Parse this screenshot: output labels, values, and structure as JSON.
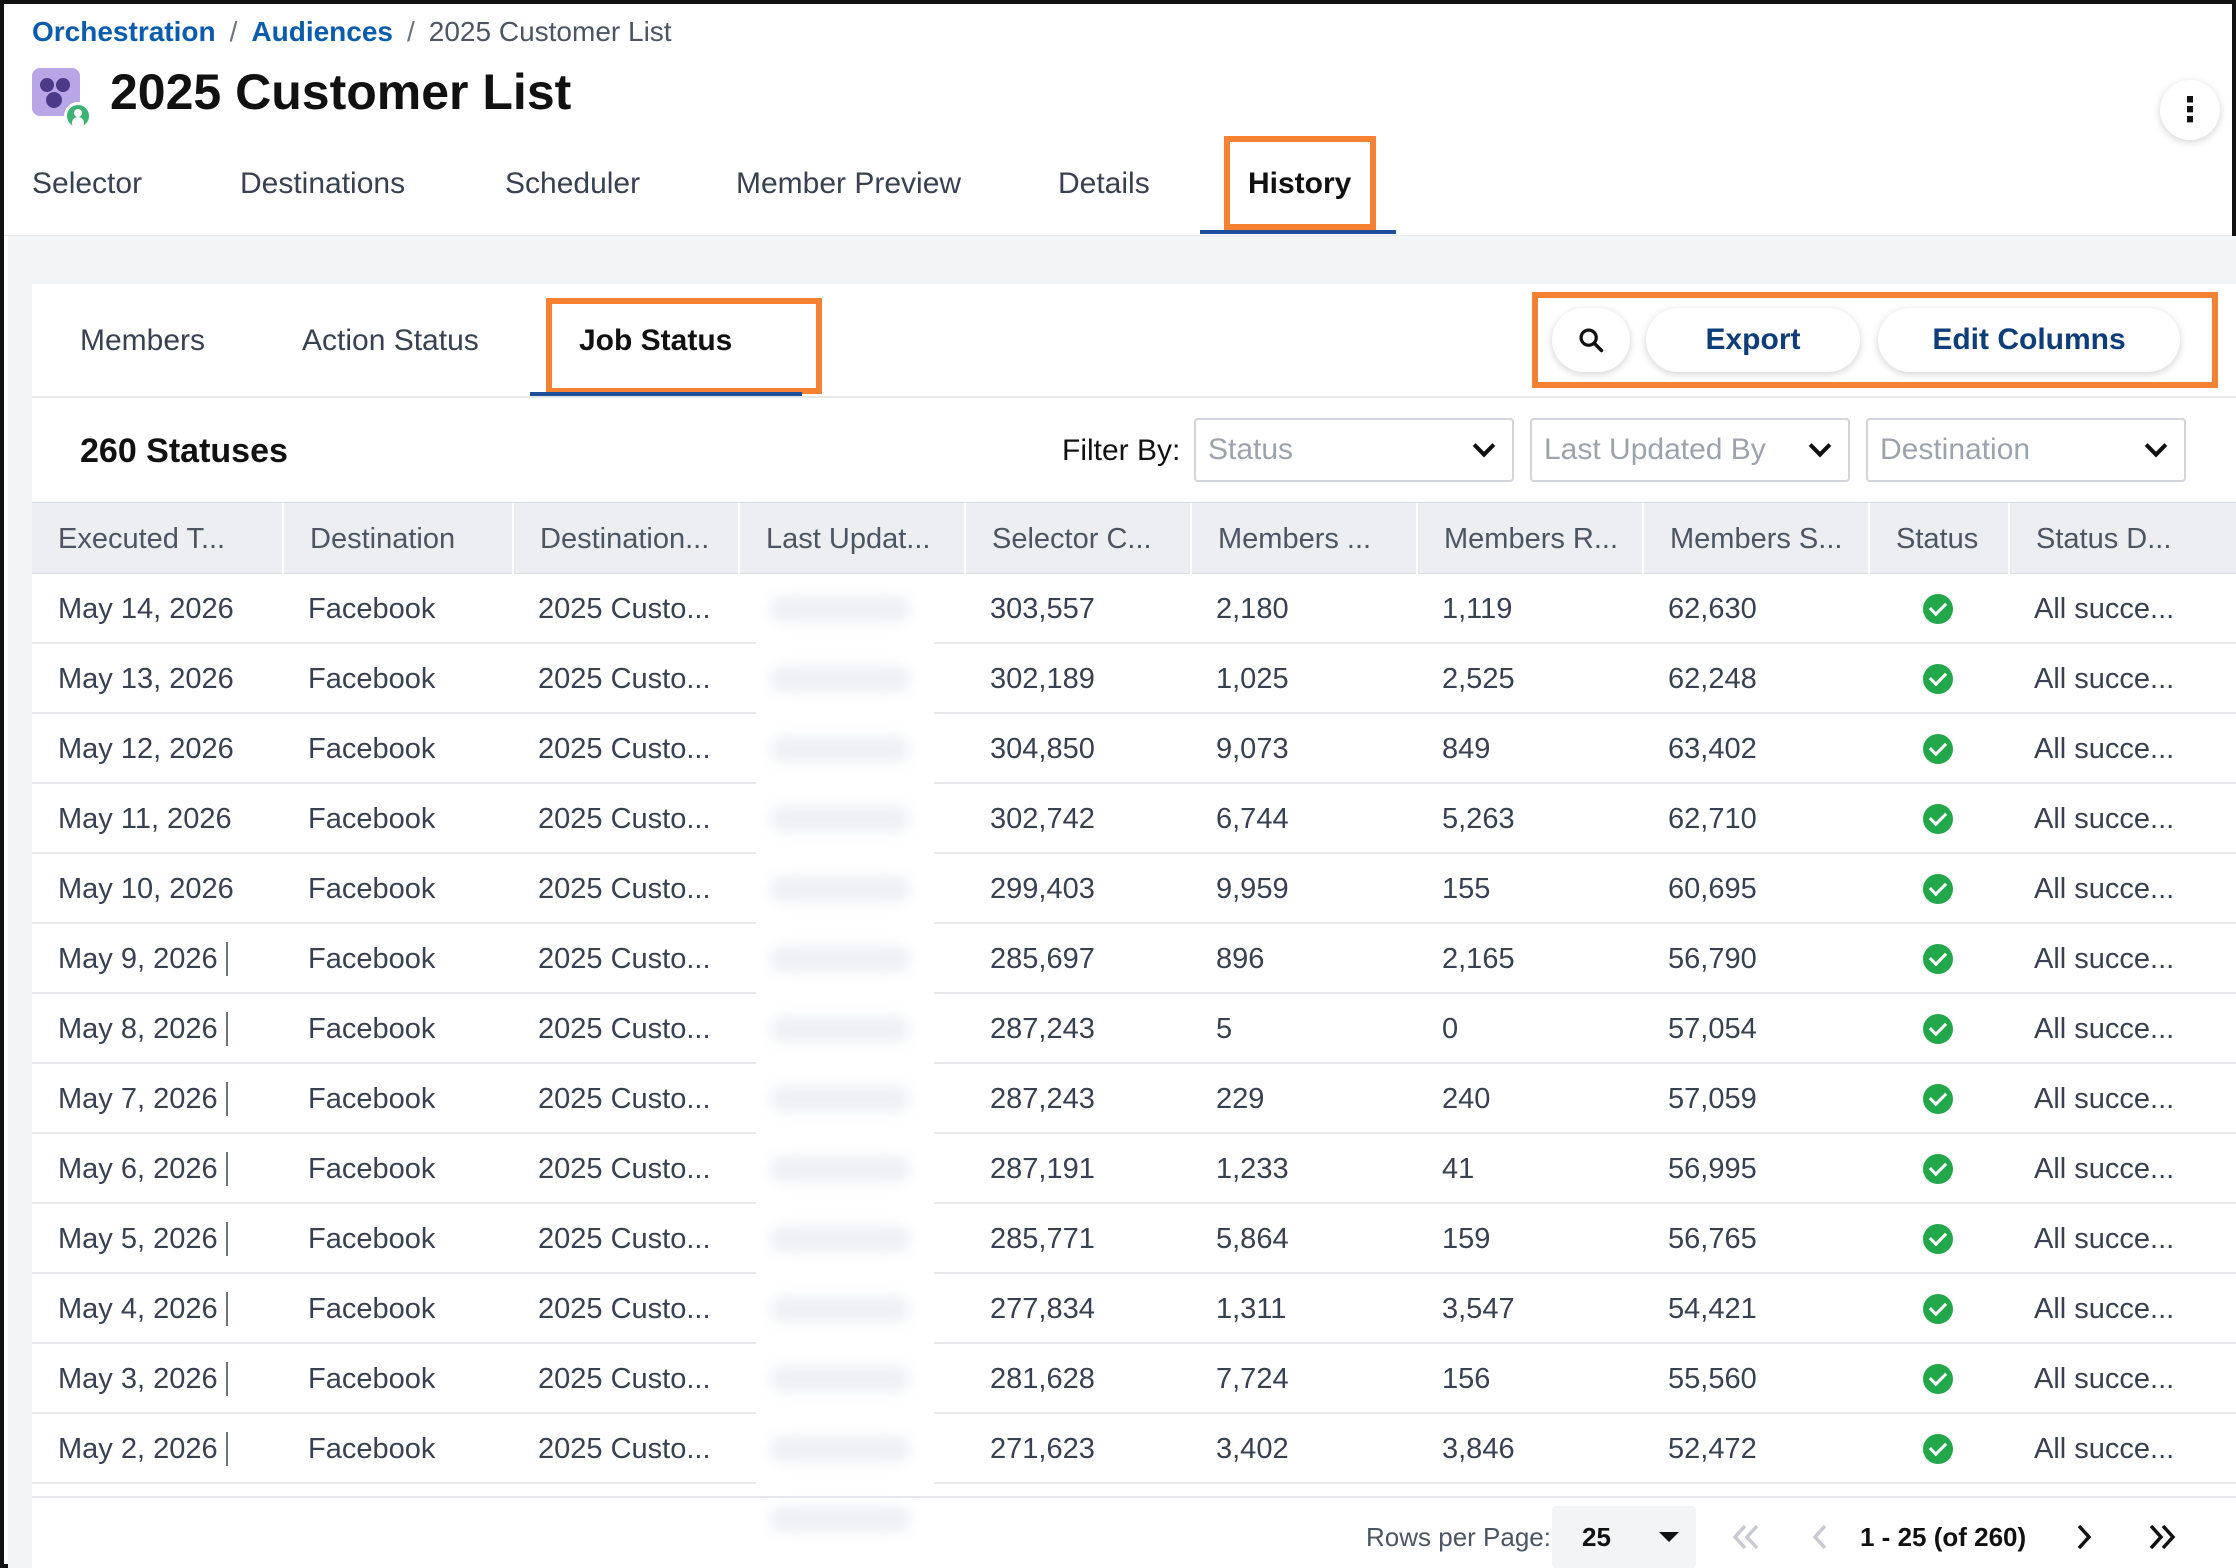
{
  "breadcrumb": {
    "items": [
      "Orchestration",
      "Audiences"
    ],
    "current": "2025 Customer List",
    "separator": "/"
  },
  "page": {
    "title": "2025 Customer List"
  },
  "menu": {
    "kebab_glyph": "⋮"
  },
  "top_tabs": {
    "items": [
      "Selector",
      "Destinations",
      "Scheduler",
      "Member Preview",
      "Details",
      "History"
    ],
    "active": "History"
  },
  "sub_tabs": {
    "items": [
      "Members",
      "Action Status",
      "Job Status"
    ],
    "active": "Job Status"
  },
  "toolbar": {
    "export_label": "Export",
    "edit_columns_label": "Edit Columns"
  },
  "summary": {
    "count_label": "260 Statuses"
  },
  "filters": {
    "label": "Filter By:",
    "status_placeholder": "Status",
    "last_updated_by_placeholder": "Last Updated By",
    "destination_placeholder": "Destination"
  },
  "table": {
    "columns": [
      "Executed T...",
      "Destination",
      "Destination...",
      "Last Updat...",
      "Selector C...",
      "Members ...",
      "Members R...",
      "Members S...",
      "Status",
      "Status D..."
    ],
    "rows": [
      {
        "date": "May 14, 2026",
        "destination": "Facebook",
        "dest_name": "2025 Custo...",
        "selector": "303,557",
        "m1": "2,180",
        "m2": "1,119",
        "m3": "62,630",
        "status_detail": "All succe...",
        "bar": false
      },
      {
        "date": "May 13, 2026",
        "destination": "Facebook",
        "dest_name": "2025 Custo...",
        "selector": "302,189",
        "m1": "1,025",
        "m2": "2,525",
        "m3": "62,248",
        "status_detail": "All succe...",
        "bar": false
      },
      {
        "date": "May 12, 2026",
        "destination": "Facebook",
        "dest_name": "2025 Custo...",
        "selector": "304,850",
        "m1": "9,073",
        "m2": "849",
        "m3": "63,402",
        "status_detail": "All succe...",
        "bar": false
      },
      {
        "date": "May 11, 2026",
        "destination": "Facebook",
        "dest_name": "2025 Custo...",
        "selector": "302,742",
        "m1": "6,744",
        "m2": "5,263",
        "m3": "62,710",
        "status_detail": "All succe...",
        "bar": false
      },
      {
        "date": "May 10, 2026",
        "destination": "Facebook",
        "dest_name": "2025 Custo...",
        "selector": "299,403",
        "m1": "9,959",
        "m2": "155",
        "m3": "60,695",
        "status_detail": "All succe...",
        "bar": false
      },
      {
        "date": "May 9, 2026",
        "destination": "Facebook",
        "dest_name": "2025 Custo...",
        "selector": "285,697",
        "m1": "896",
        "m2": "2,165",
        "m3": "56,790",
        "status_detail": "All succe...",
        "bar": true
      },
      {
        "date": "May 8, 2026",
        "destination": "Facebook",
        "dest_name": "2025 Custo...",
        "selector": "287,243",
        "m1": "5",
        "m2": "0",
        "m3": "57,054",
        "status_detail": "All succe...",
        "bar": true
      },
      {
        "date": "May 7, 2026",
        "destination": "Facebook",
        "dest_name": "2025 Custo...",
        "selector": "287,243",
        "m1": "229",
        "m2": "240",
        "m3": "57,059",
        "status_detail": "All succe...",
        "bar": true
      },
      {
        "date": "May 6, 2026",
        "destination": "Facebook",
        "dest_name": "2025 Custo...",
        "selector": "287,191",
        "m1": "1,233",
        "m2": "41",
        "m3": "56,995",
        "status_detail": "All succe...",
        "bar": true
      },
      {
        "date": "May 5, 2026",
        "destination": "Facebook",
        "dest_name": "2025 Custo...",
        "selector": "285,771",
        "m1": "5,864",
        "m2": "159",
        "m3": "56,765",
        "status_detail": "All succe...",
        "bar": true
      },
      {
        "date": "May 4, 2026",
        "destination": "Facebook",
        "dest_name": "2025 Custo...",
        "selector": "277,834",
        "m1": "1,311",
        "m2": "3,547",
        "m3": "54,421",
        "status_detail": "All succe...",
        "bar": true
      },
      {
        "date": "May 3, 2026",
        "destination": "Facebook",
        "dest_name": "2025 Custo...",
        "selector": "281,628",
        "m1": "7,724",
        "m2": "156",
        "m3": "55,560",
        "status_detail": "All succe...",
        "bar": true
      },
      {
        "date": "May 2, 2026",
        "destination": "Facebook",
        "dest_name": "2025 Custo...",
        "selector": "271,623",
        "m1": "3,402",
        "m2": "3,846",
        "m3": "52,472",
        "status_detail": "All succe...",
        "bar": true
      }
    ]
  },
  "pagination": {
    "rows_per_page_label": "Rows per Page:",
    "rows_per_page": "25",
    "range": "1 - 25 (of 260)"
  },
  "colors": {
    "accent_highlight": "#f58233",
    "link_blue": "#0b5cad",
    "button_text": "#0f3d7a",
    "success_green": "#22a84a"
  },
  "icons": {
    "search": "search-icon",
    "more": "more-vertical-icon",
    "status_ok": "check-circle-icon",
    "first_page": "chevron-double-left-icon",
    "prev_page": "chevron-left-icon",
    "next_page": "chevron-right-icon",
    "last_page": "chevron-double-right-icon"
  }
}
